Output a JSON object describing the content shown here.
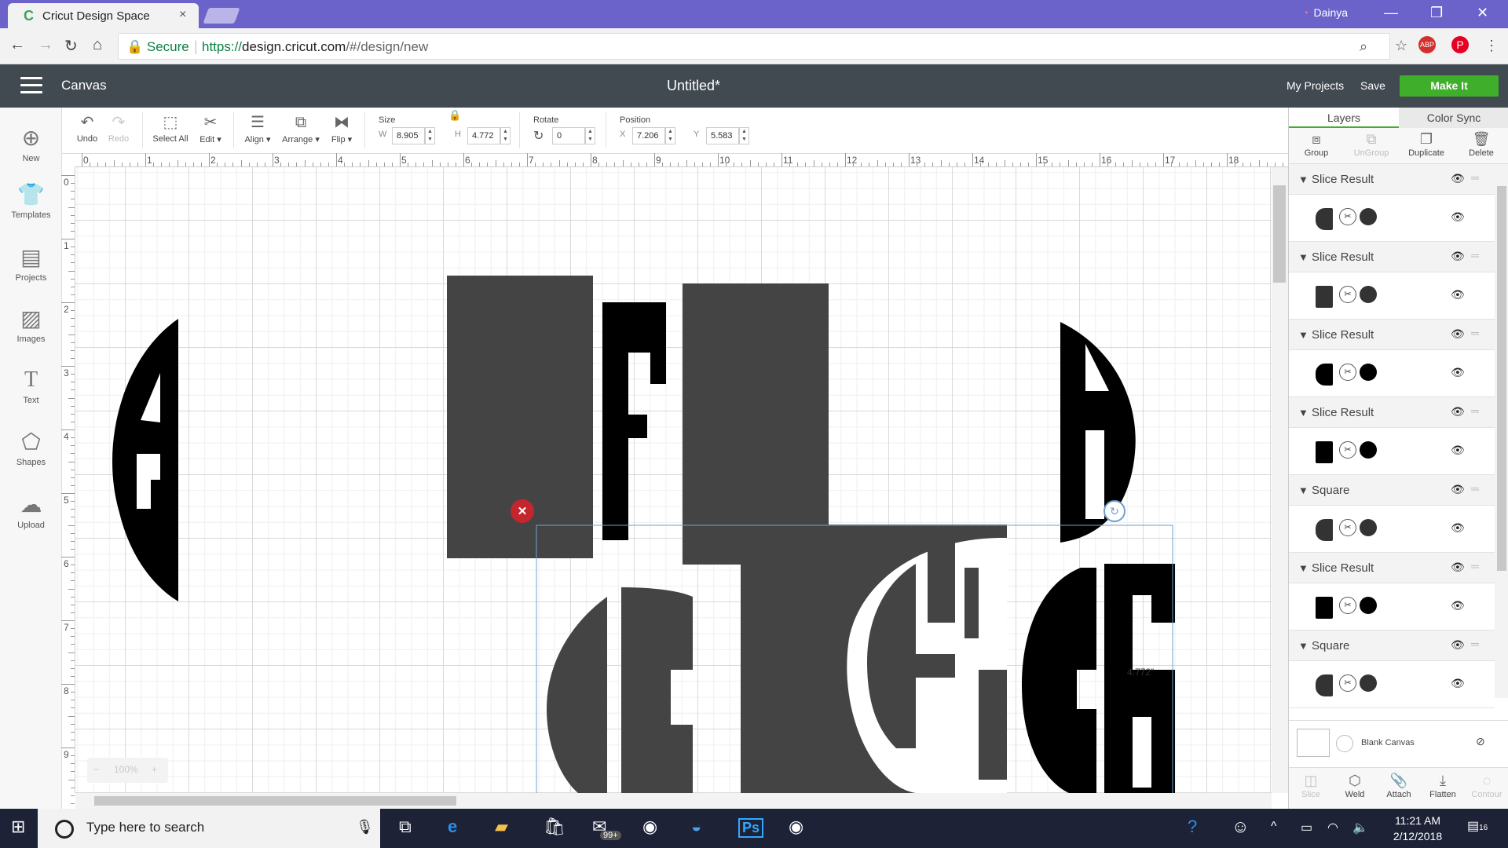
{
  "browser": {
    "tab_title": "Cricut Design Space",
    "tab_close": "×",
    "user_name": "Dainya",
    "secure_label": "Secure",
    "url_proto": "https://",
    "url_host": "design.cricut.com",
    "url_path": "/#/design/new"
  },
  "app_header": {
    "menu_icon": "hamburger-icon",
    "section": "Canvas",
    "document_title": "Untitled*",
    "my_projects": "My Projects",
    "save": "Save",
    "make_it": "Make It",
    "accent_color": "#3fae2a",
    "header_color": "#414951"
  },
  "left_nav": [
    {
      "label": "New",
      "icon": "plus-circle-icon"
    },
    {
      "label": "Templates",
      "icon": "tshirt-icon"
    },
    {
      "label": "Projects",
      "icon": "projects-icon"
    },
    {
      "label": "Images",
      "icon": "image-icon"
    },
    {
      "label": "Text",
      "icon": "text-icon"
    },
    {
      "label": "Shapes",
      "icon": "shapes-icon"
    },
    {
      "label": "Upload",
      "icon": "upload-icon"
    }
  ],
  "toolbar": {
    "undo": "Undo",
    "redo": "Redo",
    "select_all": "Select All",
    "edit": "Edit",
    "align": "Align",
    "arrange": "Arrange",
    "flip": "Flip",
    "size_label": "Size",
    "w_label": "W",
    "w_value": "8.905",
    "h_label": "H",
    "h_value": "4.772",
    "rotate_label": "Rotate",
    "rotate_value": "0",
    "position_label": "Position",
    "x_label": "X",
    "x_value": "7.206",
    "y_label": "Y",
    "y_value": "5.583"
  },
  "rulers": {
    "horizontal": [
      "0",
      "1",
      "2",
      "3",
      "4",
      "5",
      "6",
      "7",
      "8",
      "9",
      "10",
      "11",
      "12",
      "13",
      "14",
      "15",
      "16",
      "17",
      "18"
    ],
    "vertical": [
      "0",
      "1",
      "2",
      "3",
      "4",
      "5",
      "6",
      "7",
      "8",
      "9"
    ]
  },
  "canvas": {
    "dimension_label": "4.772\"",
    "zoom": "100%",
    "zoom_minus": "−",
    "zoom_plus": "+"
  },
  "right_panel": {
    "tabs": [
      "Layers",
      "Color Sync"
    ],
    "actions": [
      "Group",
      "UnGroup",
      "Duplicate",
      "Delete"
    ],
    "layers": [
      {
        "name": "Slice Result",
        "color": "#333333"
      },
      {
        "name": "Slice Result",
        "color": "#333333"
      },
      {
        "name": "Slice Result",
        "color": "#000000"
      },
      {
        "name": "Slice Result",
        "color": "#000000"
      },
      {
        "name": "Square",
        "color": "#333333"
      },
      {
        "name": "Slice Result",
        "color": "#000000"
      },
      {
        "name": "Square",
        "color": "#333333"
      }
    ],
    "blank_canvas": "Blank Canvas",
    "bottom_actions": [
      "Slice",
      "Weld",
      "Attach",
      "Flatten",
      "Contour"
    ]
  },
  "taskbar": {
    "search_placeholder": "Type here to search",
    "mail_badge": "99+",
    "time": "11:21 AM",
    "date": "2/12/2018",
    "notifications": "16"
  }
}
